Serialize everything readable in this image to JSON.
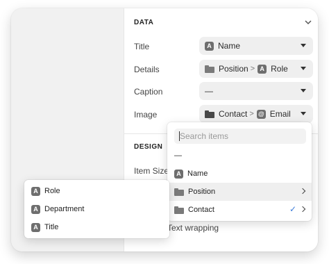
{
  "panel": {
    "data_section": {
      "title": "DATA",
      "rows": [
        {
          "label": "Title",
          "value": {
            "icon": "text-type-icon",
            "badge": "A",
            "text": "Name"
          }
        },
        {
          "label": "Details",
          "value": {
            "parts": [
              {
                "icon": "folder-icon",
                "text": "Position"
              },
              {
                "separator": ">"
              },
              {
                "icon": "text-type-icon",
                "badge": "A",
                "text": "Role"
              }
            ]
          }
        },
        {
          "label": "Caption",
          "value": {
            "text": "—"
          }
        },
        {
          "label": "Image",
          "value": {
            "parts": [
              {
                "icon": "folder-icon",
                "text": "Contact"
              },
              {
                "separator": ">"
              },
              {
                "icon": "email-icon",
                "badge": "@",
                "text": "Email"
              }
            ]
          }
        }
      ]
    },
    "design_section": {
      "title": "DESIGN",
      "item_size_label": "Item Size",
      "text_wrapping_label": "Text wrapping"
    }
  },
  "dropdown": {
    "search_placeholder": "Search items",
    "empty_option": "—",
    "items": [
      {
        "label": "Name",
        "icon": "text-type-icon",
        "badge": "A",
        "has_submenu": false,
        "selected": false
      },
      {
        "label": "Position",
        "icon": "folder-icon",
        "has_submenu": true,
        "selected": false,
        "hovered": true
      },
      {
        "label": "Contact",
        "icon": "folder-icon",
        "has_submenu": true,
        "selected": true
      }
    ],
    "check_mark": "✓"
  },
  "submenu": {
    "items": [
      {
        "label": "Role",
        "badge": "A"
      },
      {
        "label": "Department",
        "badge": "A"
      },
      {
        "label": "Title",
        "badge": "A"
      }
    ]
  },
  "colors": {
    "accent": "#3b7bd9",
    "select_bg": "#efefef",
    "hover_bg": "#efefef",
    "icon_gray": "#6e6e6e"
  }
}
